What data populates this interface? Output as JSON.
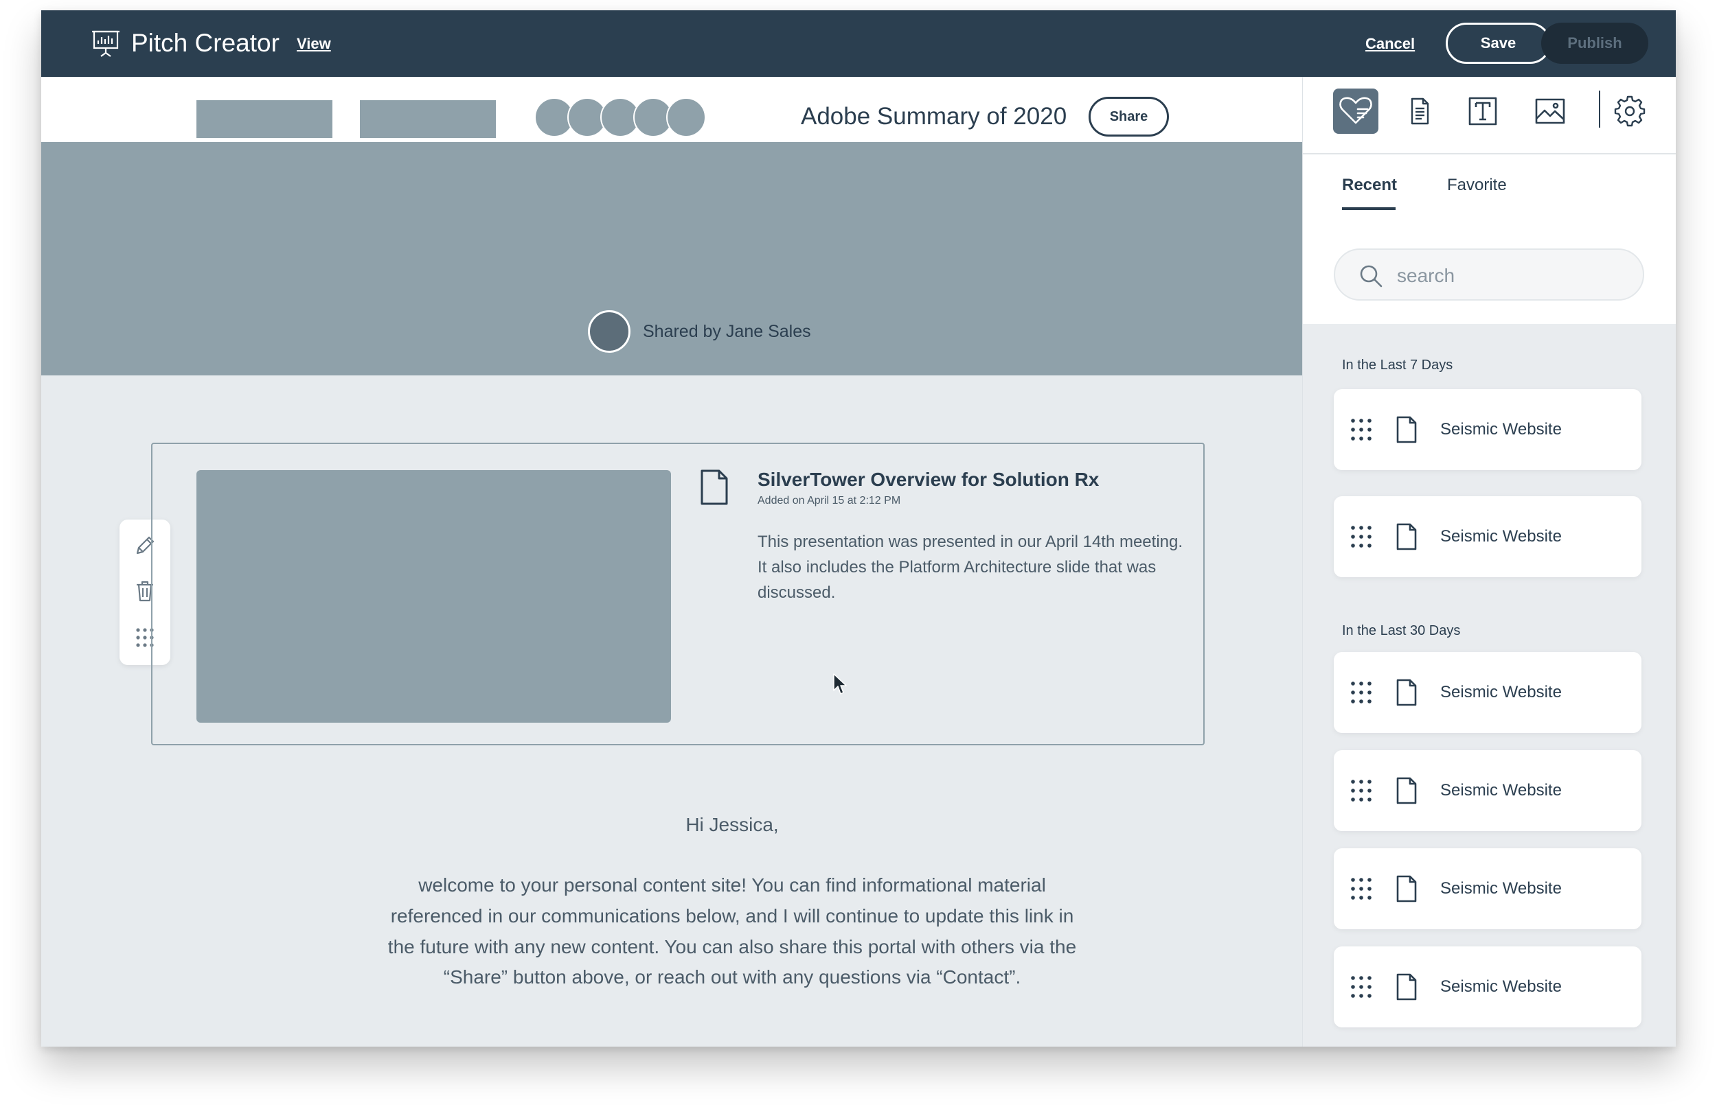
{
  "topbar": {
    "app_title": "Pitch Creator",
    "view_label": "View",
    "cancel_label": "Cancel",
    "save_label": "Save",
    "publish_label": "Publish"
  },
  "header": {
    "page_title": "Adobe Summary of 2020",
    "share_label": "Share"
  },
  "banner": {
    "shared_by": "Shared by Jane Sales"
  },
  "card": {
    "title": "SilverTower Overview for Solution Rx",
    "meta": "Added on April 15 at 2:12 PM",
    "description": "This presentation was presented in our April 14th meeting. It also includes the Platform Architecture slide that was discussed."
  },
  "message": {
    "greeting": "Hi Jessica,",
    "body": "welcome to your personal content site! You can find informational material referenced in our communications below, and I will continue to update this link in the future with any new content. You can also share this portal with others via the “Share” button above, or reach out with any questions via “Contact”."
  },
  "panel": {
    "tools": [
      "favorites-icon",
      "document-icon",
      "text-icon",
      "image-icon",
      "settings-icon"
    ],
    "tabs": [
      {
        "label": "Recent",
        "active": true
      },
      {
        "label": "Favorite",
        "active": false
      }
    ],
    "search": {
      "placeholder": "search",
      "value": ""
    },
    "sections": [
      {
        "label": "In the Last 7 Days",
        "items": [
          "Seismic Website",
          "Seismic Website"
        ]
      },
      {
        "label": "In the Last 30 Days",
        "items": [
          "Seismic Website",
          "Seismic Website",
          "Seismic Website",
          "Seismic Website"
        ]
      }
    ]
  },
  "colors": {
    "topbar": "#2b3f50",
    "placeholder": "#8fa1aa",
    "canvas": "#e7ebee",
    "text": "#2b3e4f"
  }
}
